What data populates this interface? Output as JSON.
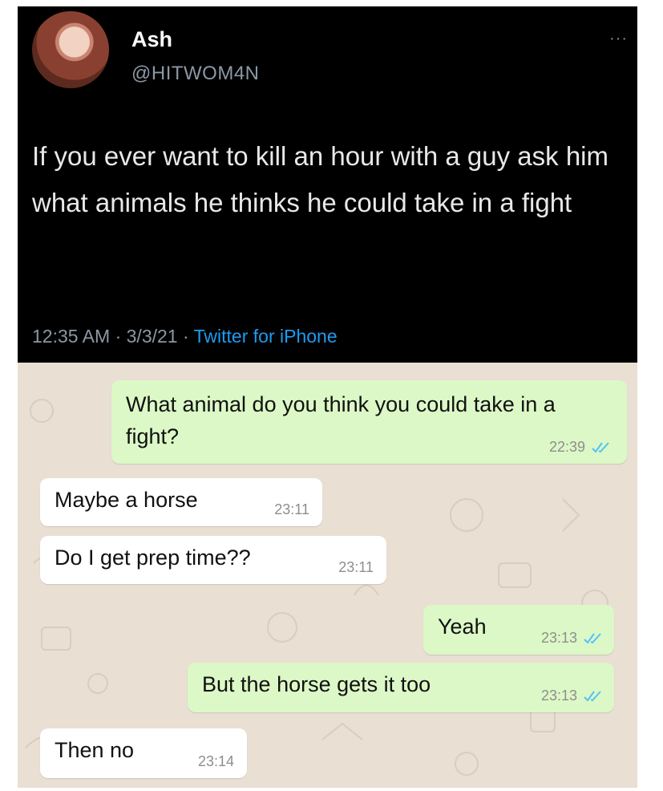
{
  "tweet": {
    "name": "Ash",
    "handle": "@HITWOM4N",
    "text": "If you ever want to kill an hour with a guy ask him what animals he thinks he could take in a fight",
    "time": "12:35 AM",
    "date": "3/3/21",
    "separator": "·",
    "source": "Twitter for iPhone",
    "menu": "···"
  },
  "chat": {
    "messages": [
      {
        "direction": "out",
        "text": "What animal do you think you could take in a fight?",
        "time": "22:39",
        "read": true
      },
      {
        "direction": "in",
        "text": "Maybe a horse",
        "time": "23:11"
      },
      {
        "direction": "in",
        "text": "Do I get prep time??",
        "time": "23:11"
      },
      {
        "direction": "out",
        "text": "Yeah",
        "time": "23:13",
        "read": true
      },
      {
        "direction": "out",
        "text": "But the horse gets it too",
        "time": "23:13",
        "read": true
      },
      {
        "direction": "in",
        "text": "Then no",
        "time": "23:14"
      }
    ]
  },
  "colors": {
    "tweet_bg": "#000000",
    "handle": "#8b98a5",
    "link": "#1d9bf0",
    "chat_bg": "#e9dfd3",
    "outgoing_bubble": "#dcf8c6",
    "incoming_bubble": "#ffffff",
    "read_ticks": "#4fc3f7"
  }
}
